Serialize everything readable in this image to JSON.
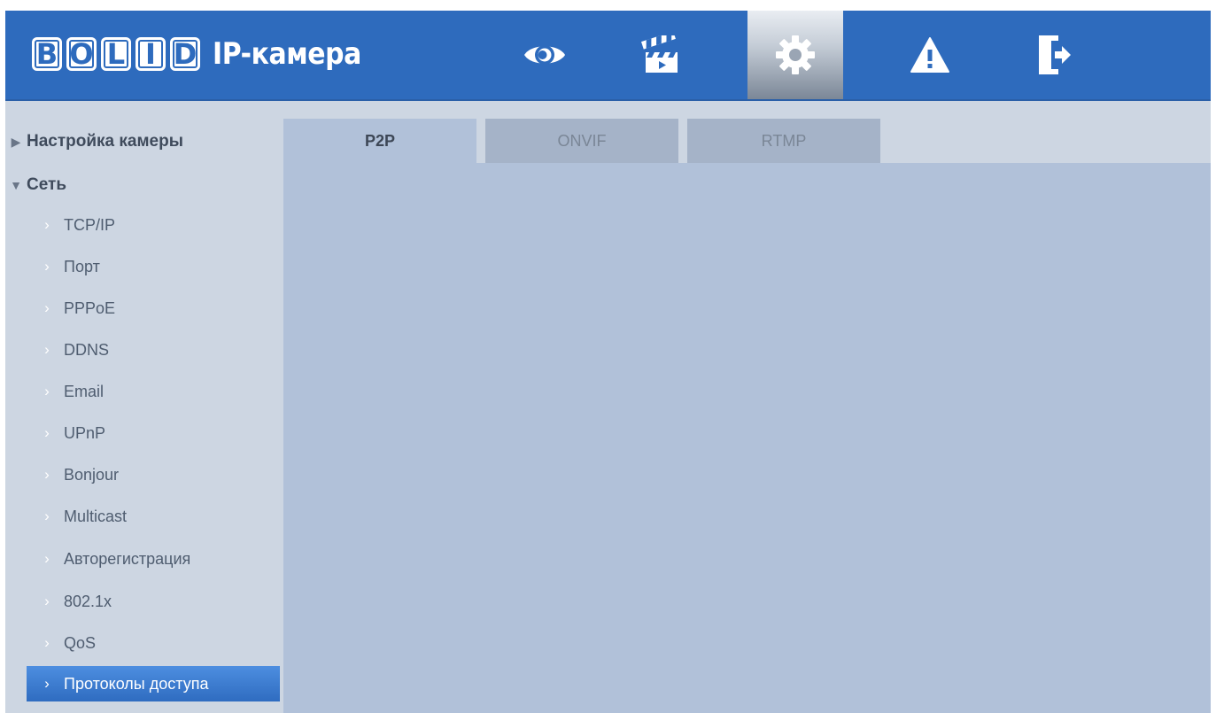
{
  "header": {
    "logo_letters": [
      "B",
      "O",
      "L",
      "I",
      "D"
    ],
    "title": "IP-камера",
    "brand_color": "#2e6bbd",
    "nav_icons": [
      {
        "name": "eye-icon",
        "active": false
      },
      {
        "name": "clapperboard-icon",
        "active": false
      },
      {
        "name": "gear-icon",
        "active": true
      },
      {
        "name": "warning-icon",
        "active": false
      },
      {
        "name": "logout-icon",
        "active": false
      }
    ]
  },
  "sidebar": {
    "groups": [
      {
        "label": "Настройка камеры",
        "expanded": false
      },
      {
        "label": "Сеть",
        "expanded": true
      }
    ],
    "items": [
      {
        "label": "TCP/IP"
      },
      {
        "label": "Порт"
      },
      {
        "label": "PPPoE"
      },
      {
        "label": "DDNS"
      },
      {
        "label": "Email"
      },
      {
        "label": "UPnP"
      },
      {
        "label": "Bonjour"
      },
      {
        "label": "Multicast"
      },
      {
        "label": "Авторегистрация"
      },
      {
        "label": "802.1x"
      },
      {
        "label": "QoS"
      },
      {
        "label": "Протоколы доступа",
        "active": true
      }
    ]
  },
  "main": {
    "tabs": [
      {
        "label": "P2P",
        "active": true
      },
      {
        "label": "ONVIF",
        "active": false
      },
      {
        "label": "RTMP",
        "active": false
      }
    ]
  }
}
